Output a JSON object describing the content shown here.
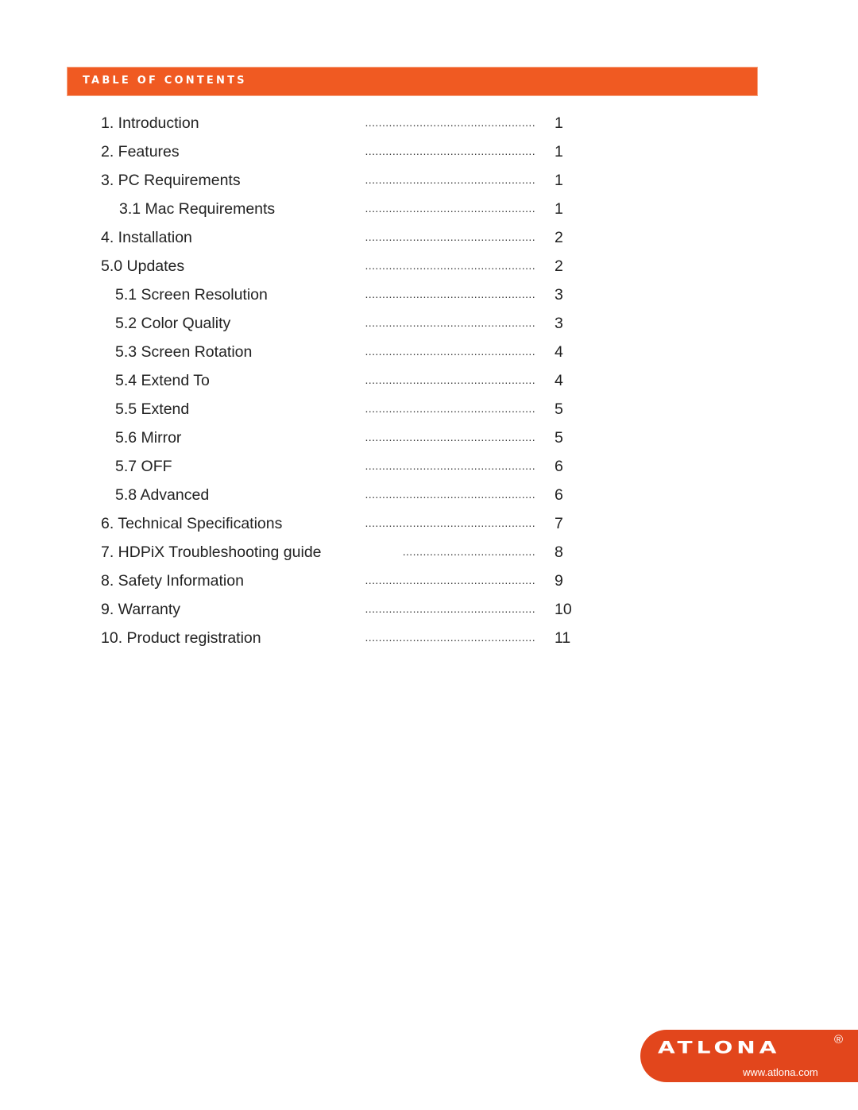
{
  "header": {
    "title": "TABLE OF CONTENTS",
    "accent_color": "#f05a22"
  },
  "toc": [
    {
      "title": "1. Introduction",
      "page": "1",
      "indent": 0
    },
    {
      "title": "2. Features",
      "page": "1",
      "indent": 0
    },
    {
      "title": "3. PC Requirements",
      "page": "1",
      "indent": 0
    },
    {
      "title": "3.1 Mac Requirements",
      "page": "1",
      "indent": 2
    },
    {
      "title": "4. Installation",
      "page": "2",
      "indent": 0
    },
    {
      "title": "5.0 Updates",
      "page": "2",
      "indent": 0
    },
    {
      "title": "5.1 Screen Resolution",
      "page": "3",
      "indent": 1
    },
    {
      "title": "5.2 Color Quality",
      "page": "3",
      "indent": 1
    },
    {
      "title": "5.3 Screen Rotation",
      "page": "4",
      "indent": 1
    },
    {
      "title": "5.4 Extend To",
      "page": "4",
      "indent": 1
    },
    {
      "title": "5.5 Extend",
      "page": "5",
      "indent": 1
    },
    {
      "title": "5.6 Mirror",
      "page": "5",
      "indent": 1
    },
    {
      "title": "5.7 OFF",
      "page": "6",
      "indent": 1
    },
    {
      "title": "5.8 Advanced",
      "page": "6",
      "indent": 1
    },
    {
      "title": "6. Technical Specifications",
      "page": "7",
      "indent": 0
    },
    {
      "title": "7. HDPiX Troubleshooting guide",
      "page": "8",
      "indent": 0
    },
    {
      "title": "8. Safety Information",
      "page": "9",
      "indent": 0
    },
    {
      "title": "9. Warranty",
      "page": "10",
      "indent": 0
    },
    {
      "title": "10. Product registration",
      "page": "11",
      "indent": 0
    }
  ],
  "leader": "..................................................",
  "short_leader": ".......................................",
  "logo": {
    "brand": "ATLONA",
    "registered": "®",
    "url": "www.atlona.com",
    "color": "#e2461c"
  }
}
